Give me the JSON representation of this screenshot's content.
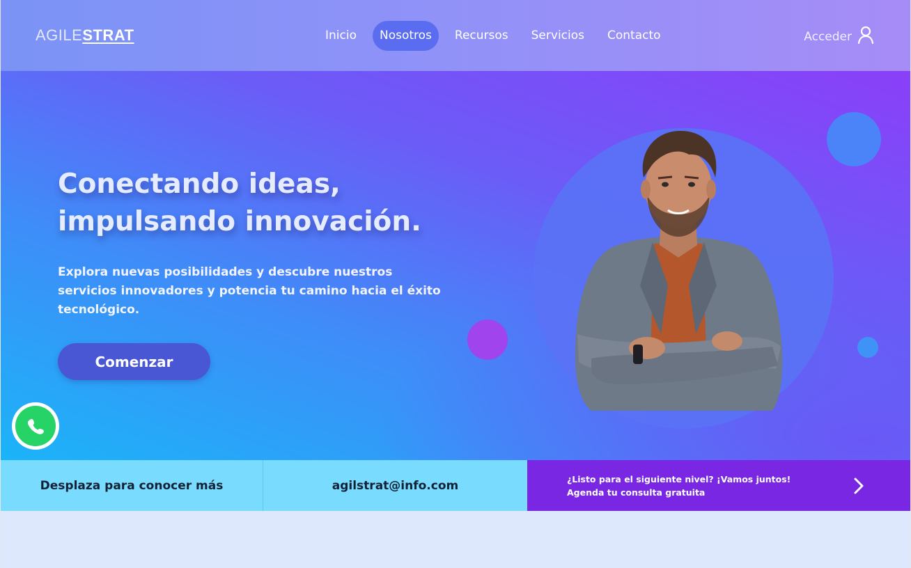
{
  "header": {
    "logo_light": "AGILE",
    "logo_bold": "STRAT",
    "nav": [
      {
        "label": "Inicio",
        "active": false
      },
      {
        "label": "Nosotros",
        "active": true
      },
      {
        "label": "Recursos",
        "active": false
      },
      {
        "label": "Servicios",
        "active": false
      },
      {
        "label": "Contacto",
        "active": false
      }
    ],
    "login_label": "Acceder",
    "login_icon": "user-icon"
  },
  "hero": {
    "headline_line1": "Conectando ideas,",
    "headline_line2": "impulsando innovación.",
    "subtext": "Explora nuevas posibilidades y descubre nuestros servicios innovadores y potencia tu camino hacia el éxito tecnológico.",
    "cta_label": "Comenzar",
    "image": "smiling-man-arms-crossed"
  },
  "floating": {
    "whatsapp_icon": "whatsapp-icon"
  },
  "infobar": {
    "scroll_hint": "Desplaza para conocer más",
    "email": "agilstrat@info.com",
    "cta_line1": "¿Listo para el siguiente nivel? ¡Vamos juntos!",
    "cta_line2": "Agenda tu consulta gratuita",
    "cta_icon": "chevron-right-icon"
  },
  "colors": {
    "accent": "#5a6cf0",
    "cta_button": "#4a57d4",
    "info_light": "#79dbfd",
    "info_purple": "#7a27e4",
    "whatsapp": "#25d366"
  }
}
